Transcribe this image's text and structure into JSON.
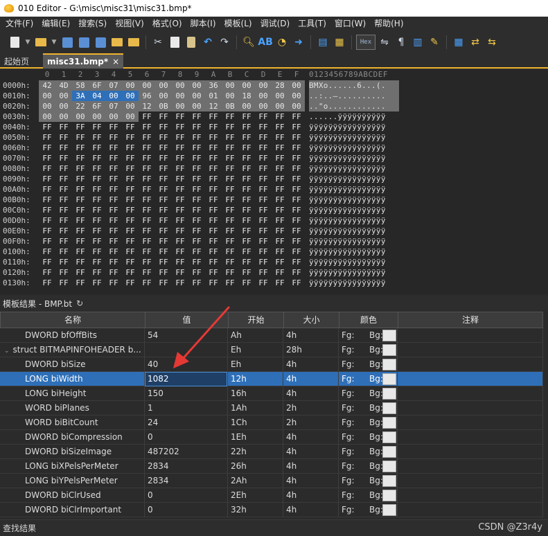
{
  "window": {
    "title": "010 Editor - G:\\misc\\misc31\\misc31.bmp*"
  },
  "menu": [
    "文件(F)",
    "编辑(E)",
    "搜索(S)",
    "视图(V)",
    "格式(O)",
    "脚本(I)",
    "模板(L)",
    "调试(D)",
    "工具(T)",
    "窗口(W)",
    "帮助(H)"
  ],
  "toolbar": {
    "hex_label": "Hex",
    "pilcrow": "¶"
  },
  "tabs": {
    "home": "起始页",
    "active": "misc31.bmp*",
    "close": "×"
  },
  "hex": {
    "column_header": [
      "0",
      "1",
      "2",
      "3",
      "4",
      "5",
      "6",
      "7",
      "8",
      "9",
      "A",
      "B",
      "C",
      "D",
      "E",
      "F"
    ],
    "ascii_header": "0123456789ABCDEF",
    "rows": [
      {
        "addr": "0000h:",
        "bytes": [
          "42",
          "4D",
          "58",
          "6F",
          "07",
          "00",
          "00",
          "00",
          "00",
          "00",
          "36",
          "00",
          "00",
          "00",
          "28",
          "00"
        ],
        "ascii": "BMXo......6...(.",
        "header_count": 16,
        "sel": []
      },
      {
        "addr": "0010h:",
        "bytes": [
          "00",
          "00",
          "3A",
          "04",
          "00",
          "00",
          "96",
          "00",
          "00",
          "00",
          "01",
          "00",
          "18",
          "00",
          "00",
          "00"
        ],
        "ascii": "..:..–..........",
        "header_count": 16,
        "sel": [
          2,
          3,
          4,
          5
        ]
      },
      {
        "addr": "0020h:",
        "bytes": [
          "00",
          "00",
          "22",
          "6F",
          "07",
          "00",
          "12",
          "0B",
          "00",
          "00",
          "12",
          "0B",
          "00",
          "00",
          "00",
          "00"
        ],
        "ascii": "..\"o............",
        "header_count": 16,
        "sel": []
      },
      {
        "addr": "0030h:",
        "bytes": [
          "00",
          "00",
          "00",
          "00",
          "00",
          "00",
          "FF",
          "FF",
          "FF",
          "FF",
          "FF",
          "FF",
          "FF",
          "FF",
          "FF",
          "FF"
        ],
        "ascii": "......ÿÿÿÿÿÿÿÿÿÿ",
        "header_count": 6,
        "sel": []
      },
      {
        "addr": "0040h:",
        "bytes": "FF",
        "ascii": "ÿÿÿÿÿÿÿÿÿÿÿÿÿÿÿÿ"
      },
      {
        "addr": "0050h:",
        "bytes": "FF",
        "ascii": "ÿÿÿÿÿÿÿÿÿÿÿÿÿÿÿÿ"
      },
      {
        "addr": "0060h:",
        "bytes": "FF",
        "ascii": "ÿÿÿÿÿÿÿÿÿÿÿÿÿÿÿÿ"
      },
      {
        "addr": "0070h:",
        "bytes": "FF",
        "ascii": "ÿÿÿÿÿÿÿÿÿÿÿÿÿÿÿÿ"
      },
      {
        "addr": "0080h:",
        "bytes": "FF",
        "ascii": "ÿÿÿÿÿÿÿÿÿÿÿÿÿÿÿÿ"
      },
      {
        "addr": "0090h:",
        "bytes": "FF",
        "ascii": "ÿÿÿÿÿÿÿÿÿÿÿÿÿÿÿÿ"
      },
      {
        "addr": "00A0h:",
        "bytes": "FF",
        "ascii": "ÿÿÿÿÿÿÿÿÿÿÿÿÿÿÿÿ"
      },
      {
        "addr": "00B0h:",
        "bytes": "FF",
        "ascii": "ÿÿÿÿÿÿÿÿÿÿÿÿÿÿÿÿ"
      },
      {
        "addr": "00C0h:",
        "bytes": "FF",
        "ascii": "ÿÿÿÿÿÿÿÿÿÿÿÿÿÿÿÿ"
      },
      {
        "addr": "00D0h:",
        "bytes": "FF",
        "ascii": "ÿÿÿÿÿÿÿÿÿÿÿÿÿÿÿÿ"
      },
      {
        "addr": "00E0h:",
        "bytes": "FF",
        "ascii": "ÿÿÿÿÿÿÿÿÿÿÿÿÿÿÿÿ"
      },
      {
        "addr": "00F0h:",
        "bytes": "FF",
        "ascii": "ÿÿÿÿÿÿÿÿÿÿÿÿÿÿÿÿ"
      },
      {
        "addr": "0100h:",
        "bytes": "FF",
        "ascii": "ÿÿÿÿÿÿÿÿÿÿÿÿÿÿÿÿ"
      },
      {
        "addr": "0110h:",
        "bytes": "FF",
        "ascii": "ÿÿÿÿÿÿÿÿÿÿÿÿÿÿÿÿ"
      },
      {
        "addr": "0120h:",
        "bytes": "FF",
        "ascii": "ÿÿÿÿÿÿÿÿÿÿÿÿÿÿÿÿ"
      },
      {
        "addr": "0130h:",
        "bytes": "FF",
        "ascii": "ÿÿÿÿÿÿÿÿÿÿÿÿÿÿÿÿ"
      }
    ]
  },
  "template": {
    "title": "模板结果 - BMP.bt",
    "columns": [
      "名称",
      "值",
      "开始",
      "大小",
      "颜色",
      "注释"
    ],
    "fg_label": "Fg:",
    "bg_label": "Bg:",
    "rows": [
      {
        "name": "DWORD bfOffBits",
        "value": "54",
        "start": "Ah",
        "size": "4h",
        "level": 1,
        "selected": false
      },
      {
        "name": "struct BITMAPINFOHEADER b...",
        "value": "",
        "start": "Eh",
        "size": "28h",
        "level": 0,
        "selected": false,
        "expanded": true
      },
      {
        "name": "DWORD biSize",
        "value": "40",
        "start": "Eh",
        "size": "4h",
        "level": 1,
        "selected": false
      },
      {
        "name": "LONG biWidth",
        "value": "1082",
        "start": "12h",
        "size": "4h",
        "level": 1,
        "selected": true
      },
      {
        "name": "LONG biHeight",
        "value": "150",
        "start": "16h",
        "size": "4h",
        "level": 1,
        "selected": false
      },
      {
        "name": "WORD biPlanes",
        "value": "1",
        "start": "1Ah",
        "size": "2h",
        "level": 1,
        "selected": false
      },
      {
        "name": "WORD biBitCount",
        "value": "24",
        "start": "1Ch",
        "size": "2h",
        "level": 1,
        "selected": false
      },
      {
        "name": "DWORD biCompression",
        "value": "0",
        "start": "1Eh",
        "size": "4h",
        "level": 1,
        "selected": false
      },
      {
        "name": "DWORD biSizeImage",
        "value": "487202",
        "start": "22h",
        "size": "4h",
        "level": 1,
        "selected": false
      },
      {
        "name": "LONG biXPelsPerMeter",
        "value": "2834",
        "start": "26h",
        "size": "4h",
        "level": 1,
        "selected": false
      },
      {
        "name": "LONG biYPelsPerMeter",
        "value": "2834",
        "start": "2Ah",
        "size": "4h",
        "level": 1,
        "selected": false
      },
      {
        "name": "DWORD biClrUsed",
        "value": "0",
        "start": "2Eh",
        "size": "4h",
        "level": 1,
        "selected": false
      },
      {
        "name": "DWORD biClrImportant",
        "value": "0",
        "start": "32h",
        "size": "4h",
        "level": 1,
        "selected": false
      }
    ]
  },
  "status": {
    "left": "查找结果",
    "watermark": "CSDN @Z3r4y"
  },
  "colors": {
    "accent_tab": "#f0b429",
    "selection": "#2e6fb8",
    "arrow": "#e53935"
  }
}
